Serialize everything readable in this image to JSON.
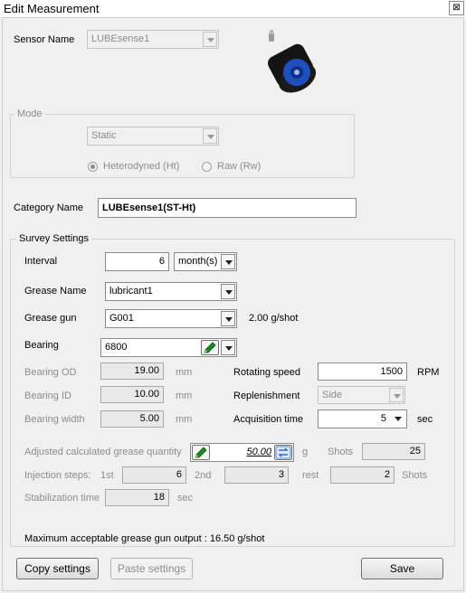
{
  "window": {
    "title": "Edit Measurement",
    "close_glyph": "⊠"
  },
  "sensor": {
    "label": "Sensor Name",
    "value": "LUBEsense1"
  },
  "mode": {
    "legend": "Mode",
    "select_value": "Static",
    "options": [
      "Heterodyned (Ht)",
      "Raw (Rw)"
    ],
    "selected_option": "Heterodyned (Ht)"
  },
  "category": {
    "label": "Category Name",
    "value": "LUBEsense1(ST-Ht)"
  },
  "survey": {
    "legend": "Survey Settings",
    "interval": {
      "label": "Interval",
      "value": "6",
      "unit": "month(s)"
    },
    "grease_name": {
      "label": "Grease Name",
      "value": "lubricant1"
    },
    "grease_gun": {
      "label": "Grease gun",
      "value": "G001",
      "rate": "2.00 g/shot"
    },
    "bearing": {
      "label": "Bearing",
      "value": "6800"
    },
    "bearing_od": {
      "label": "Bearing OD",
      "value": "19.00",
      "unit": "mm"
    },
    "bearing_id": {
      "label": "Bearing ID",
      "value": "10.00",
      "unit": "mm"
    },
    "bearing_width": {
      "label": "Bearing width",
      "value": "5.00",
      "unit": "mm"
    },
    "rotating_speed": {
      "label": "Rotating speed",
      "value": "1500",
      "unit": "RPM"
    },
    "replenishment": {
      "label": "Replenishment",
      "value": "Side"
    },
    "acquisition_time": {
      "label": "Acquisition time",
      "value": "5",
      "unit": "sec"
    },
    "adjusted": {
      "label": "Adjusted calculated grease quantity",
      "value": "50.00",
      "unit": "g"
    },
    "shots": {
      "label": "Shots",
      "value": "25"
    },
    "injection": {
      "label": "Injection steps:",
      "first_label": "1st",
      "first_value": "6",
      "second_label": "2nd",
      "second_value": "3",
      "rest_label": "rest",
      "rest_value": "2",
      "unit": "Shots"
    },
    "stabilization": {
      "label": "Stabilization time",
      "value": "18",
      "unit": "sec"
    }
  },
  "max_output": {
    "label": "Maximum acceptable grease gun output :",
    "value": "16.50 g/shot"
  },
  "buttons": {
    "copy": "Copy settings",
    "paste": "Paste settings",
    "save": "Save"
  },
  "icons": {
    "pencil": "pencil-icon",
    "swap": "swap-icon",
    "sensor": "sensor-image"
  },
  "colors": {
    "sensor_blue": "#1f4fbf",
    "pencil_green": "#1e8a1e"
  }
}
